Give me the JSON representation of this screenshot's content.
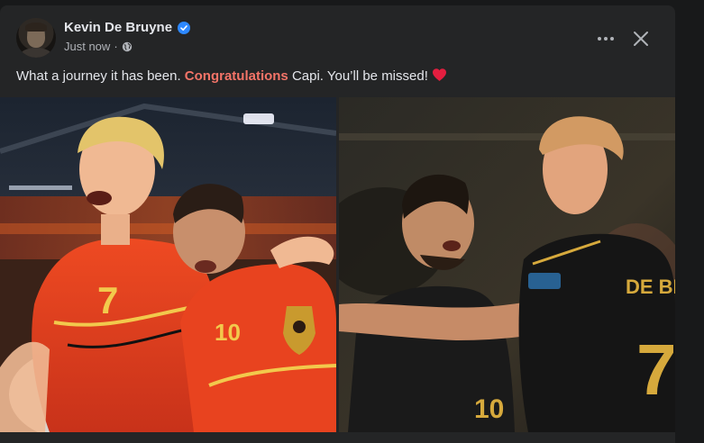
{
  "post": {
    "author": "Kevin De Bruyne",
    "timestamp": "Just now",
    "separator": "·",
    "privacy_icon": "globe-icon",
    "verified_icon": "verified-badge-icon",
    "text_before": "What a journey it has been. ",
    "text_highlight": "Congratulations",
    "text_after": " Capi. You’ll be missed!",
    "emoji": "red-heart-icon"
  },
  "photos": {
    "left": {
      "shirt_number_front": "7",
      "shirt_number_second": "10"
    },
    "right": {
      "shirt_name": "DE BRUY",
      "shirt_number_right": "7",
      "shirt_number_left": "10"
    }
  },
  "colors": {
    "background": "#18191a",
    "card": "#242526",
    "text_primary": "#e4e6eb",
    "text_secondary": "#b0b3b8",
    "highlight": "#f47468",
    "verified": "#2d88ff",
    "heart": "#e41e3f"
  }
}
